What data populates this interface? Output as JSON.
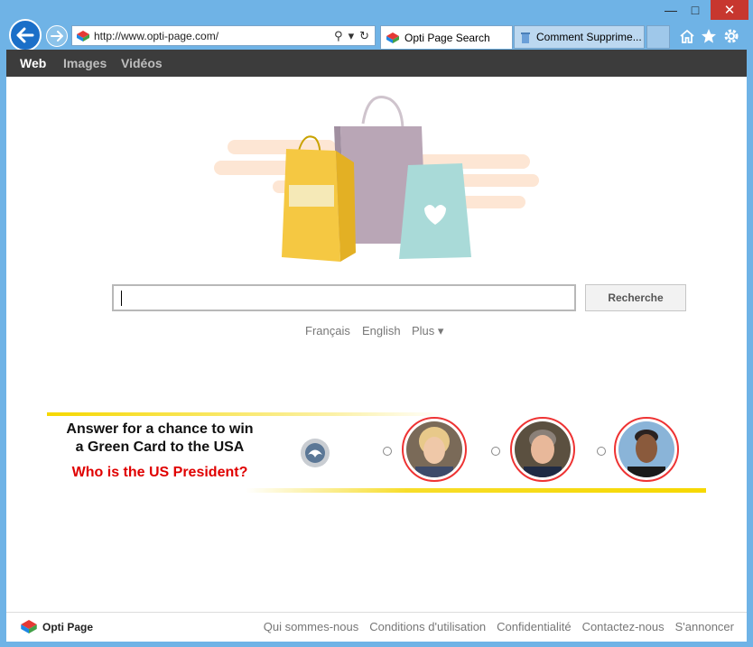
{
  "browser": {
    "url": "http://www.opti-page.com/",
    "tabs": [
      {
        "label": "Opti Page Search",
        "active": true
      },
      {
        "label": "Comment Supprime...",
        "active": false
      }
    ]
  },
  "nav": {
    "items": [
      "Web",
      "Images",
      "Vidéos"
    ],
    "active": "Web"
  },
  "search": {
    "value": "",
    "button_label": "Recherche"
  },
  "languages": [
    "Français",
    "English",
    "Plus ▾"
  ],
  "banner": {
    "question_line1": "Answer for a chance to win",
    "question_line2": "a Green Card to the USA",
    "prompt": "Who is the US President?"
  },
  "footer": {
    "brand": "Opti Page",
    "links": [
      "Qui sommes-nous",
      "Conditions d'utilisation",
      "Confidentialité",
      "Contactez-nous",
      "S'annoncer"
    ]
  },
  "colors": {
    "nav_bg": "#3c3c3c",
    "accent_red": "#e00000",
    "banner_yellow": "#f6d800",
    "ie_blue": "#1b6fc8"
  }
}
